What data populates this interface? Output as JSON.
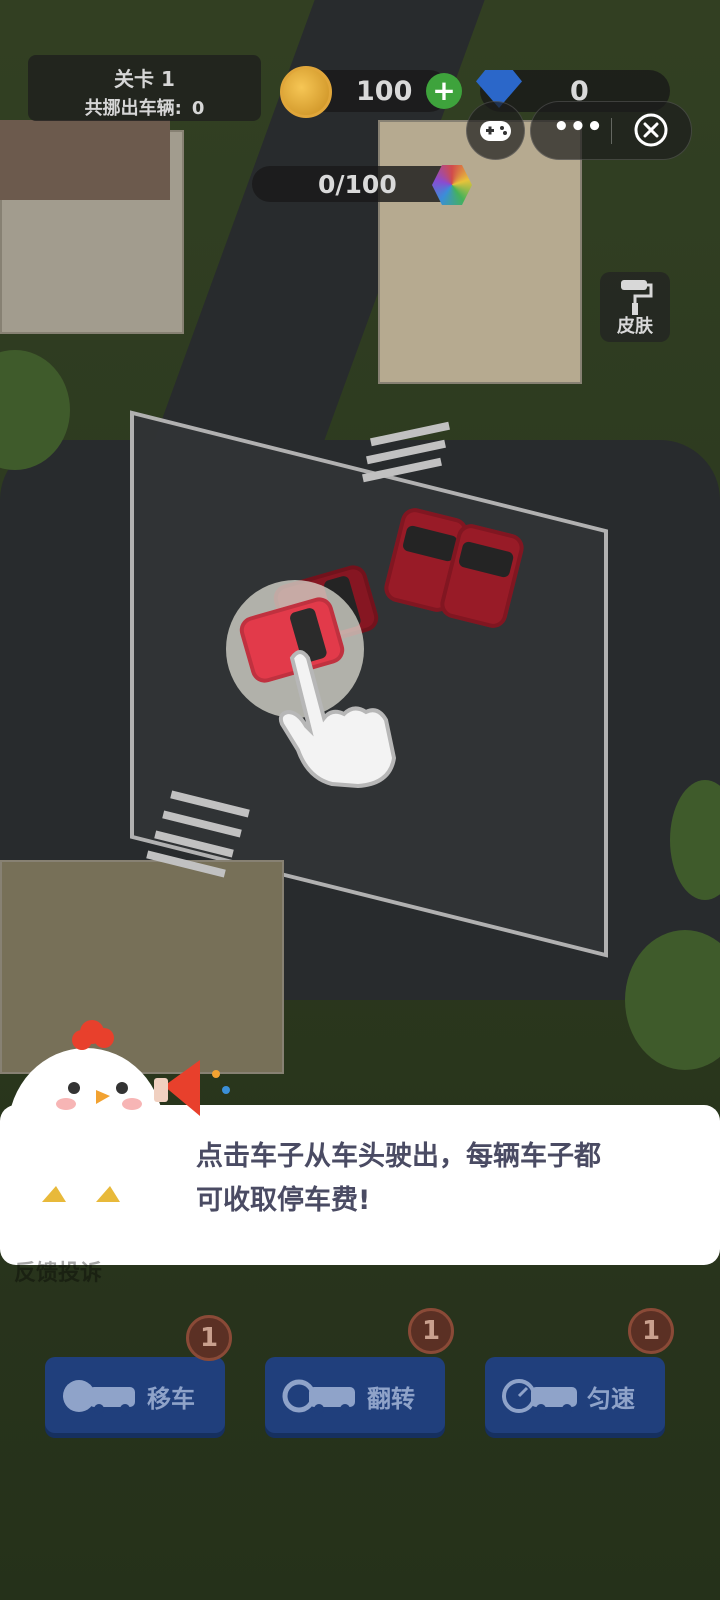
{
  "hud": {
    "level_title": "关卡 1",
    "moved_label": "共挪出车辆:",
    "moved_count": "0",
    "coins": "100",
    "gems": "0",
    "progress": "0/100",
    "skin_label": "皮肤"
  },
  "miniprogram_controls": {
    "more_icon": "•••",
    "close_icon": "⊗",
    "gamepad_icon": "gamepad-icon"
  },
  "tutorial": {
    "message_line1": "点击车子从车头驶出，每辆车子都",
    "message_line2": "可收取停车费!",
    "faded_text": "反馈投诉"
  },
  "powerups": [
    {
      "label": "移车",
      "badge": "1",
      "icon": "wrench-car-icon"
    },
    {
      "label": "翻转",
      "badge": "1",
      "icon": "rotate-car-icon"
    },
    {
      "label": "匀速",
      "badge": "1",
      "icon": "speedometer-car-icon"
    }
  ],
  "colors": {
    "button_blue": "#203f7c",
    "badge_brown": "#5b3024",
    "dialog_text": "#4a4b63",
    "car_red": "#b3202e"
  }
}
